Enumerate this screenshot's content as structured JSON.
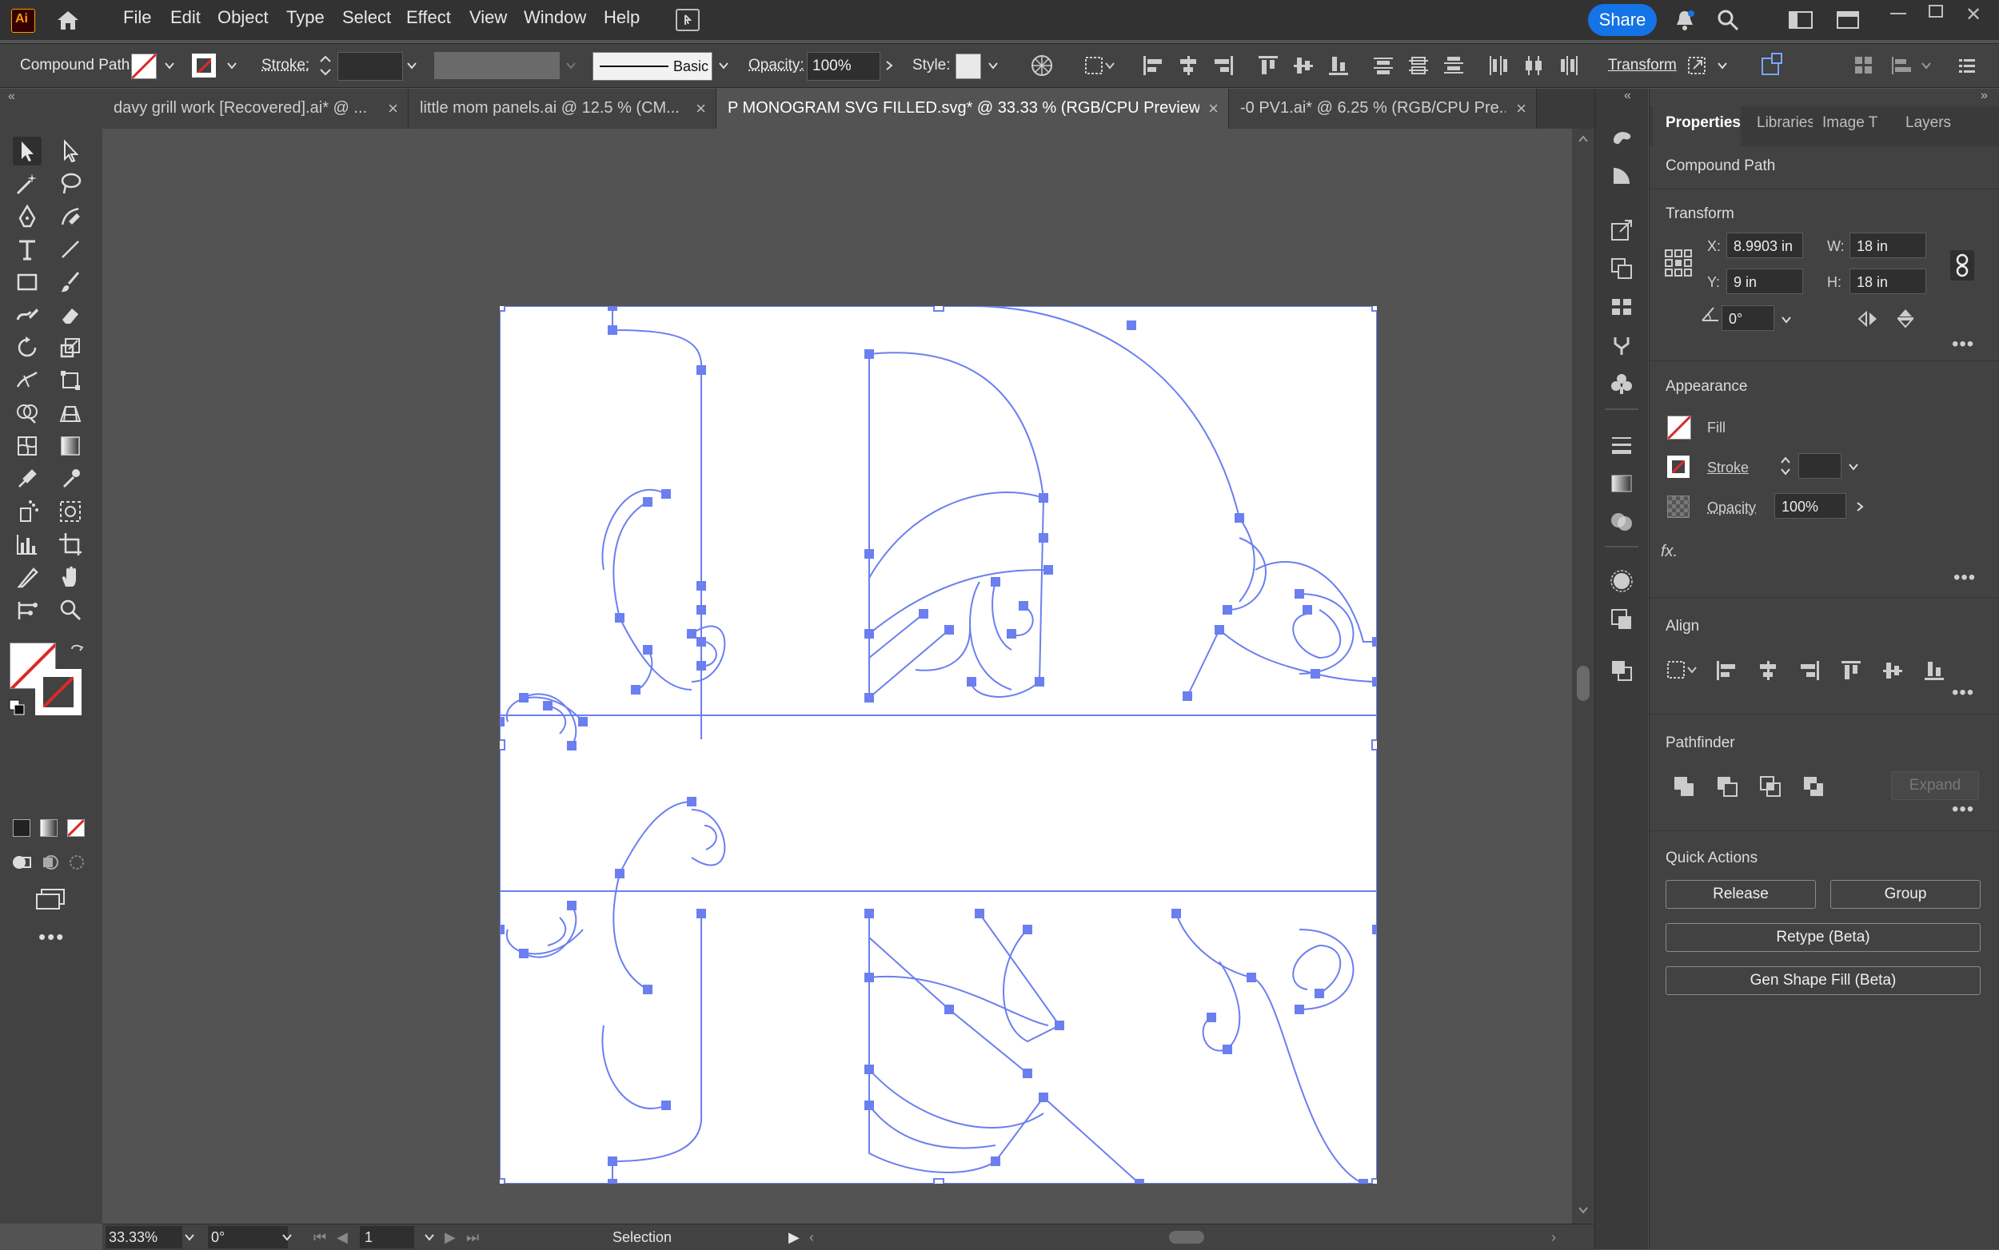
{
  "app": {
    "logo": "Ai"
  },
  "menu": [
    "File",
    "Edit",
    "Object",
    "Type",
    "Select",
    "Effect",
    "View",
    "Window",
    "Help"
  ],
  "share_label": "Share",
  "control_bar": {
    "selection_type": "Compound Path",
    "stroke_label": "Stroke:",
    "stroke_style": "Basic",
    "opacity_label": "Opacity:",
    "opacity_value": "100%",
    "style_label": "Style:",
    "transform_label": "Transform"
  },
  "tabs": [
    {
      "label": "davy grill work [Recovered].ai* @ ...",
      "active": false
    },
    {
      "label": "little mom panels.ai @ 12.5 % (CM...",
      "active": false
    },
    {
      "label": "P MONOGRAM SVG FILLED.svg* @ 33.33 % (RGB/CPU Preview)",
      "active": true
    },
    {
      "label": "-0 PV1.ai* @ 6.25 % (RGB/CPU Pre...",
      "active": false
    }
  ],
  "status": {
    "zoom": "33.33%",
    "rotation": "0°",
    "artboard_number": "1",
    "tool": "Selection"
  },
  "panel": {
    "tabs": [
      "Properties",
      "Libraries",
      "Image T",
      "Layers"
    ],
    "object_type": "Compound Path",
    "transform": {
      "title": "Transform",
      "x_label": "X:",
      "x_value": "8.9903 in",
      "y_label": "Y:",
      "y_value": "9 in",
      "w_label": "W:",
      "w_value": "18 in",
      "h_label": "H:",
      "h_value": "18 in",
      "angle_value": "0°"
    },
    "appearance": {
      "title": "Appearance",
      "fill_label": "Fill",
      "stroke_label": "Stroke",
      "opacity_label": "Opacity",
      "opacity_value": "100%",
      "fx_label": "fx."
    },
    "align": {
      "title": "Align"
    },
    "pathfinder": {
      "title": "Pathfinder",
      "expand_label": "Expand"
    },
    "quick_actions": {
      "title": "Quick Actions",
      "release_label": "Release",
      "group_label": "Group",
      "retype_label": "Retype (Beta)",
      "gen_shape_fill_label": "Gen Shape Fill (Beta)"
    }
  },
  "colors": {
    "accent_blue": "#1473e6",
    "selection_blue": "#6b7ff0",
    "fill_none_red": "#d92b2b"
  }
}
